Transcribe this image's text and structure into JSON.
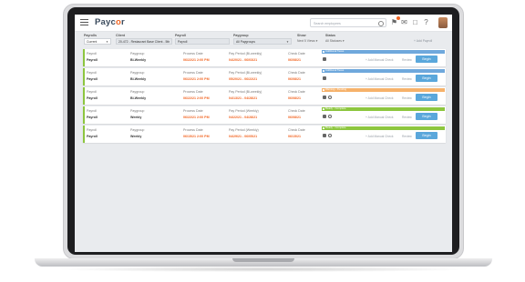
{
  "app": {
    "logo_main": "Payc",
    "logo_accent": "o",
    "logo_tail": "r"
  },
  "header": {
    "search_placeholder": "Search employees",
    "icons": [
      "menu-icon",
      "search-icon",
      "notification-icon",
      "chat-icon",
      "message-icon",
      "help-icon"
    ]
  },
  "filters": {
    "payroll_label": "Payrolls",
    "payroll_value": "Current",
    "client_label": "Client",
    "client_value": "20-472 - Restaurant Base Client - 5th",
    "payroll2_label": "Payroll",
    "payroll2_value": "Payroll",
    "paygroup_label": "Paygroup",
    "paygroup_value": "All Paygroups",
    "show_label": "Show",
    "show_value": "Next 5 Views",
    "status_label": "Status",
    "status_value": "All Statuses",
    "add_payroll": "+ Add Payroll"
  },
  "columns": {
    "payroll": "Payroll",
    "paygroup": "Paygroup",
    "process_date": "Process Date",
    "pay_period": "Pay Period (Bi-weekly)",
    "check_date": "Check Date"
  },
  "rows": [
    {
      "payroll": "Payroll",
      "paygroup": "Bi-Weekly",
      "process_date": "06/22/21 2:00 PM",
      "period_label": "Pay Period (Bi-weekly)",
      "pay_period": "04/20/21 - 06/03/21",
      "check_date": "06/08/21",
      "status": "Additional Taxes",
      "status_color": "#6fa8dc",
      "bar_color": "#8dc63f"
    },
    {
      "payroll": "Payroll",
      "paygroup": "Bi-Weekly",
      "process_date": "06/22/21 2:00 PM",
      "period_label": "Pay Period (Bi-weekly)",
      "pay_period": "05/20/21 - 06/22/21",
      "check_date": "06/08/21",
      "status": "Additional Taxes",
      "status_color": "#6fa8dc",
      "bar_color": "#8dc63f"
    },
    {
      "payroll": "Payroll",
      "paygroup": "Bi-Weekly",
      "process_date": "06/22/21 2:00 PM",
      "period_label": "Pay Period (Bi-weekly)",
      "pay_period": "04/13/21 - 04/28/21",
      "check_date": "06/08/21",
      "status": "Warning - Pending",
      "status_color": "#f6b26b",
      "bar_color": "#8dc63f"
    },
    {
      "payroll": "Payroll",
      "paygroup": "Weekly",
      "process_date": "06/22/21 2:00 PM",
      "period_label": "Pay Period (Weekly)",
      "pay_period": "04/22/21 - 04/28/21",
      "check_date": "06/08/21",
      "status": "Ready - Complete",
      "status_color": "#8dc63f",
      "bar_color": "#8dc63f"
    },
    {
      "payroll": "Payroll",
      "paygroup": "Weekly",
      "process_date": "06/15/21 2:00 PM",
      "period_label": "Pay Period (Weekly)",
      "pay_period": "04/29/21 - 06/05/21",
      "check_date": "06/15/21",
      "status": "Ready - Complete",
      "status_color": "#8dc63f",
      "bar_color": "#8dc63f"
    }
  ],
  "row_labels": {
    "payroll_lbl": "Payroll",
    "paygroup_lbl": "Paygroup",
    "process_lbl": "Process Date",
    "check_lbl": "Check Date",
    "add_manual": "+ Add Manual Check",
    "review": "Review",
    "begin": "Begin"
  }
}
